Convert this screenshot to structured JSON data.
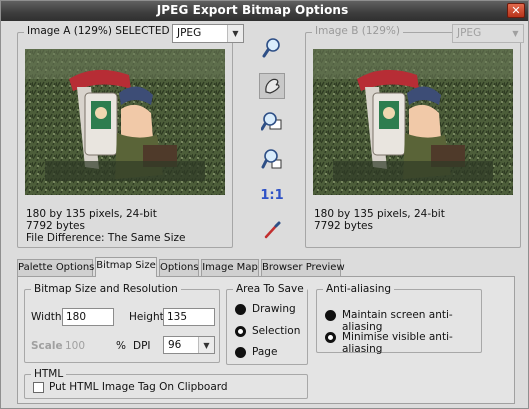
{
  "window": {
    "title": "JPEG Export Bitmap Options",
    "close_label": "✕"
  },
  "image_a": {
    "legend": "Image A (129%) SELECTED",
    "format": "JPEG",
    "info": [
      "180 by 135 pixels, 24-bit",
      "7792 bytes",
      "File Difference: The Same Size"
    ]
  },
  "image_b": {
    "legend": "Image B (129%)",
    "format": "JPEG",
    "info": [
      "180 by 135 pixels, 24-bit",
      "7792 bytes"
    ]
  },
  "toolbar": {
    "tools": [
      "zoom-in-icon",
      "pan-hand-icon",
      "zoom-in-region-icon",
      "zoom-to-fit-icon",
      "actual-size-icon",
      "colour-picker-icon"
    ],
    "actual_size_label": "1:1",
    "active_tool": "pan-hand-icon",
    "accent": "#2f52c6"
  },
  "tabs": [
    {
      "label": "Palette Options"
    },
    {
      "label": "Bitmap Size",
      "active": true
    },
    {
      "label": "Options"
    },
    {
      "label": "Image Map"
    },
    {
      "label": "Browser Preview"
    }
  ],
  "bitmap_size": {
    "legend": "Bitmap Size and Resolution",
    "width_label": "Width",
    "width_value": "180",
    "height_label": "Height",
    "height_value": "135",
    "scale_label": "Scale",
    "scale_value": "100",
    "scale_unit": "%",
    "dpi_label": "DPI",
    "dpi_value": "96"
  },
  "area_to_save": {
    "legend": "Area To Save",
    "options": [
      "Drawing",
      "Selection",
      "Page"
    ],
    "selected": "Selection"
  },
  "anti_aliasing": {
    "legend": "Anti-aliasing",
    "options": [
      "Maintain screen anti-aliasing",
      "Minimise visible anti-aliasing"
    ],
    "selected": "Minimise visible anti-aliasing"
  },
  "html": {
    "legend": "HTML",
    "checkbox_label": "Put HTML Image Tag On Clipboard",
    "checked": false
  }
}
